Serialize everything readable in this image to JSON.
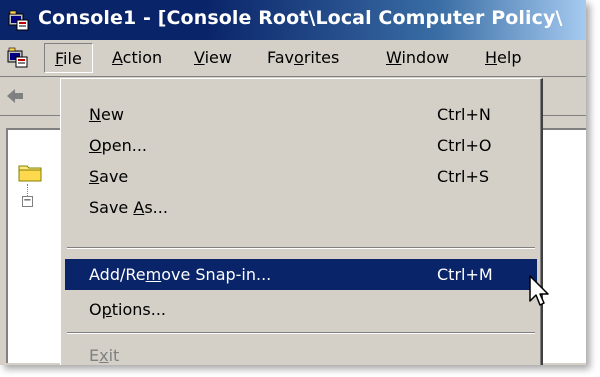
{
  "window": {
    "title": "Console1 - [Console Root\\Local Computer Policy\\"
  },
  "menubar": {
    "items": [
      {
        "name": "file",
        "prefix": "",
        "accel": "F",
        "suffix": "ile"
      },
      {
        "name": "action",
        "prefix": "",
        "accel": "A",
        "suffix": "ction"
      },
      {
        "name": "view",
        "prefix": "",
        "accel": "V",
        "suffix": "iew"
      },
      {
        "name": "favorites",
        "prefix": "Fav",
        "accel": "o",
        "suffix": "rites"
      },
      {
        "name": "window",
        "prefix": "",
        "accel": "W",
        "suffix": "indow"
      },
      {
        "name": "help",
        "prefix": "",
        "accel": "H",
        "suffix": "elp"
      }
    ]
  },
  "file_menu": {
    "items": [
      {
        "prefix": "",
        "accel": "N",
        "suffix": "ew",
        "shortcut": "Ctrl+N"
      },
      {
        "prefix": "",
        "accel": "O",
        "suffix": "pen...",
        "shortcut": "Ctrl+O"
      },
      {
        "prefix": "",
        "accel": "S",
        "suffix": "ave",
        "shortcut": "Ctrl+S"
      },
      {
        "prefix": "Save ",
        "accel": "A",
        "suffix": "s...",
        "shortcut": ""
      },
      {
        "prefix": "Add/Re",
        "accel": "m",
        "suffix": "ove Snap-in...",
        "shortcut": "Ctrl+M"
      },
      {
        "prefix": "O",
        "accel": "p",
        "suffix": "tions...",
        "shortcut": ""
      },
      {
        "prefix": "E",
        "accel": "x",
        "suffix": "it",
        "shortcut": ""
      }
    ],
    "highlighted_index": 4
  },
  "colors": {
    "title_bar": "#0a246a",
    "highlight": "#0a246a",
    "chrome": "#d4d0c8"
  },
  "icons": {
    "app": "mmc-console-icon",
    "back": "back-arrow-icon",
    "tree": "folder-icon",
    "cursor": "mouse-pointer-icon"
  }
}
